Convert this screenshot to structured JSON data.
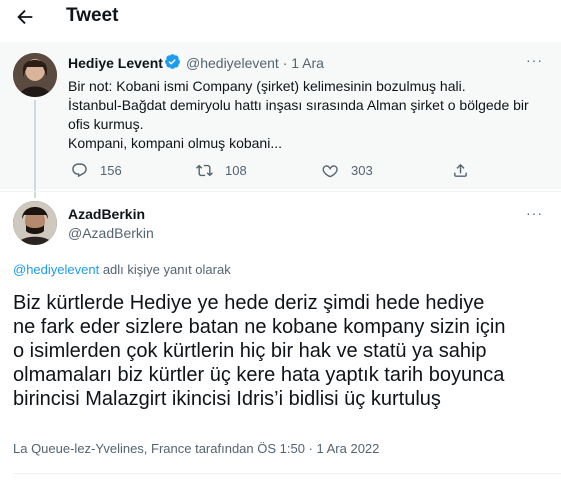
{
  "header": {
    "title": "Tweet",
    "back_icon": "arrow-left-icon"
  },
  "parent_tweet": {
    "name": "Hediye Levent",
    "handle": "@hediyelevent",
    "date": "· 1 Ara",
    "body_lines": [
      "Bir not: Kobani ismi Company (şirket) kelimesinin bozulmuş hali.",
      "İstanbul-Bağdat demiryolu hattı inşası sırasında Alman şirket o bölgede bir",
      "ofis kurmuş.",
      "Kompani, kompani olmuş kobani..."
    ],
    "replies": "156",
    "retweets": "108",
    "likes": "303",
    "verified_color": "#1d9bf0"
  },
  "main_tweet": {
    "name": "AzadBerkin",
    "handle": "@AzadBerkin",
    "reply_to_handle": "@hediyelevent",
    "reply_to_suffix": " adlı kişiye yanıt olarak",
    "text_lines": [
      "Biz kürtlerde Hediye ye hede deriz şimdi hede hediye",
      "ne fark eder sizlere batan ne kobane kompany sizin için",
      "o isimlerden çok kürtlerin hiç bir hak ve statü ya sahip",
      "olmamaları biz kürtler üç kere hata yaptık tarih boyunca",
      "birincisi Malazgirt ikincisi Idris’i bidlisi üç kurtuluş"
    ],
    "meta": "La Queue-lez-Yvelines, France tarafından ÖS 1:50 · 1 Ara 2022"
  },
  "more_label": "···",
  "colors": {
    "accent": "#1d9bf0",
    "muted": "#536471",
    "text": "#0f1419",
    "reply_bg": "#f7f9f9"
  }
}
